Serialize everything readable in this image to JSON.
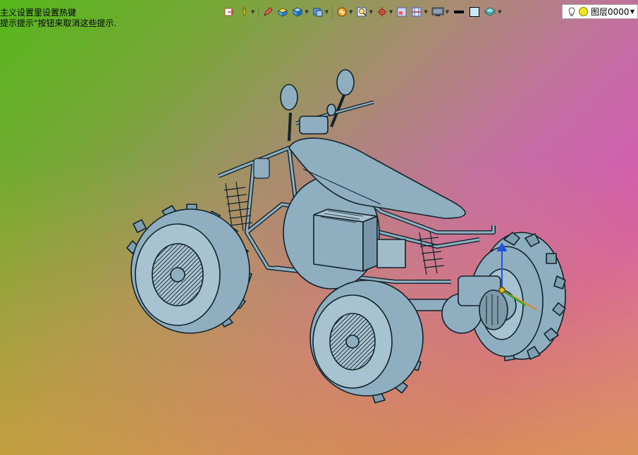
{
  "hints": {
    "line1": "主义设置里设置热键",
    "line2": "提示提示\"按钮来取消这些提示."
  },
  "toolbar": {
    "buttons": [
      {
        "name": "exit-sketch-icon"
      },
      {
        "name": "pen-icon"
      },
      {
        "name": "pencil-edit-icon"
      },
      {
        "name": "solid-block-icon"
      },
      {
        "name": "shaded-cube-icon"
      },
      {
        "name": "view-cube-icon"
      },
      {
        "name": "render-style-icon"
      },
      {
        "name": "zoom-icon"
      },
      {
        "name": "snap-target-icon"
      },
      {
        "name": "window-icon"
      },
      {
        "name": "section-icon"
      },
      {
        "name": "display-icon"
      },
      {
        "name": "line-weight-icon"
      },
      {
        "name": "color-swatch-icon"
      },
      {
        "name": "stack-icon"
      }
    ]
  },
  "layer": {
    "label": "图层0000"
  },
  "colors": {
    "model_fill": "#8faebf",
    "model_stroke": "#10222b",
    "axis_x": "#e08a1a",
    "axis_y": "#22aa22",
    "axis_z": "#2255dd"
  }
}
